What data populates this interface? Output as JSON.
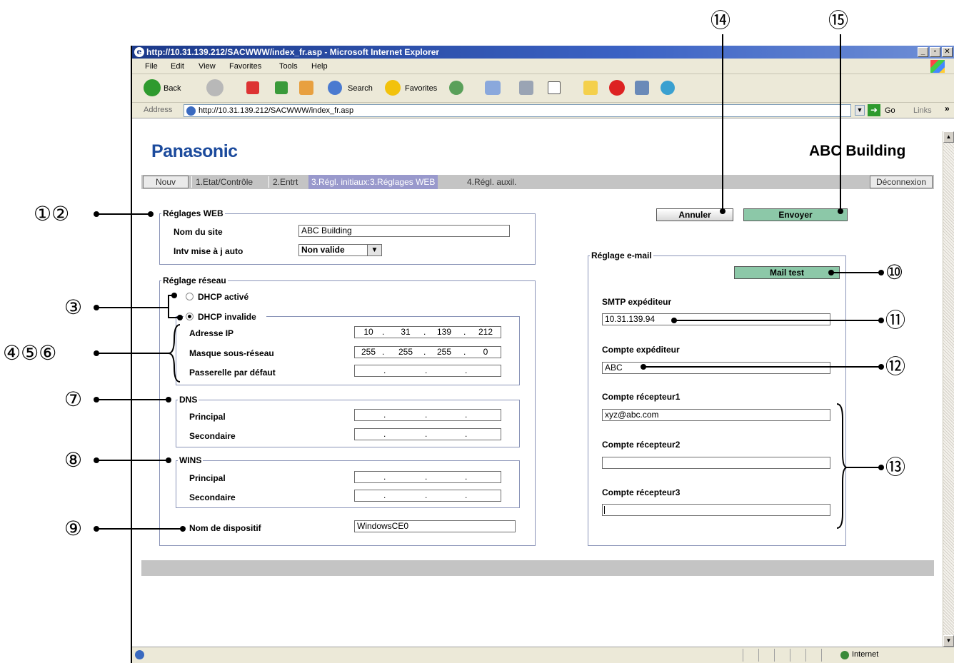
{
  "browser": {
    "title": "http://10.31.139.212/SACWWW/index_fr.asp - Microsoft Internet Explorer",
    "menu": [
      "File",
      "Edit",
      "View",
      "Favorites",
      "Tools",
      "Help"
    ],
    "toolbar": {
      "back": "Back",
      "search": "Search",
      "favorites": "Favorites"
    },
    "address_label": "Address",
    "address": "http://10.31.139.212/SACWWW/index_fr.asp",
    "go": "Go",
    "links": "Links",
    "status_zone": "Internet",
    "winbtns": [
      "_",
      "▫",
      "✕"
    ]
  },
  "page": {
    "brand": "Panasonic",
    "building": "ABC Building",
    "nav": {
      "nouv": "Nouv",
      "tab1": "1.Etat/Contrôle",
      "tab2": "2.Entrt",
      "tab3": "3.Régl. initiaux:3.Réglages WEB",
      "tab4": "4.Régl. auxil.",
      "logout": "Déconnexion"
    },
    "web": {
      "legend": "Réglages WEB",
      "site_label": "Nom du site",
      "site_value": "ABC Building",
      "interval_label": "Intv mise à j auto",
      "interval_value": "Non valide"
    },
    "network": {
      "legend": "Réglage réseau",
      "dhcp_on": "DHCP activé",
      "dhcp_off": "DHCP invalide",
      "ip_label": "Adresse IP",
      "ip": [
        "10",
        "31",
        "139",
        "212"
      ],
      "mask_label": "Masque sous-réseau",
      "mask": [
        "255",
        "255",
        "255",
        "0"
      ],
      "gw_label": "Passerelle par défaut",
      "dns_legend": "DNS",
      "wins_legend": "WINS",
      "primary": "Principal",
      "secondary": "Secondaire",
      "device_label": "Nom de dispositif",
      "device_value": "WindowsCE0"
    },
    "actions": {
      "cancel": "Annuler",
      "send": "Envoyer"
    },
    "email": {
      "legend": "Réglage e-mail",
      "test": "Mail test",
      "smtp_label": "SMTP expéditeur",
      "smtp_value": "10.31.139.94",
      "sender_label": "Compte expéditeur",
      "sender_value": "ABC",
      "r1_label": "Compte récepteur1",
      "r1_value": "xyz@abc.com",
      "r2_label": "Compte récepteur2",
      "r3_label": "Compte récepteur3"
    }
  },
  "callouts": {
    "c12": "①②",
    "c3": "③",
    "c456": "④⑤⑥",
    "c7": "⑦",
    "c8": "⑧",
    "c9": "⑨",
    "c10": "⑩",
    "c11": "⑪",
    "c12b": "⑫",
    "c13": "⑬",
    "c14": "⑭",
    "c15": "⑮"
  }
}
